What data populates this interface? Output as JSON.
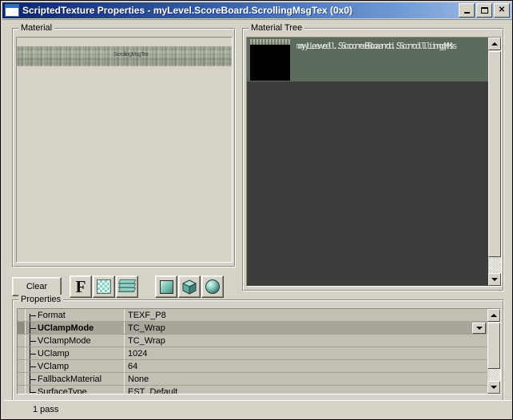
{
  "window": {
    "title": "ScriptedTexture Properties - myLevel.ScoreBoard.ScrollingMsgTex (0x0)",
    "icon": "window-icon",
    "controls": {
      "minimize": "minimize-icon",
      "maximize": "maximize-icon",
      "close": "✕"
    }
  },
  "material_panel": {
    "label": "Material",
    "preview_caption": "ScrollingMsgTex",
    "toolbar": {
      "clear_label": "Clear",
      "buttons": [
        {
          "name": "font-icon",
          "glyph": "F"
        },
        {
          "name": "checker-icon",
          "glyph": ""
        },
        {
          "name": "layers-icon",
          "glyph": ""
        },
        {
          "name": "plane-icon",
          "glyph": ""
        },
        {
          "name": "cube-icon",
          "glyph": ""
        },
        {
          "name": "sphere-icon",
          "glyph": ""
        }
      ]
    }
  },
  "material_tree": {
    "label": "Material Tree",
    "node_label": "myLevel.ScoreBoard.ScrollingMs"
  },
  "properties": {
    "label": "Properties",
    "selected_row": 1,
    "rows": [
      {
        "name": "Format",
        "value": "TEXF_P8"
      },
      {
        "name": "UClampMode",
        "value": "TC_Wrap"
      },
      {
        "name": "VClampMode",
        "value": "TC_Wrap"
      },
      {
        "name": "UClamp",
        "value": "1024"
      },
      {
        "name": "VClamp",
        "value": "64"
      },
      {
        "name": "FallbackMaterial",
        "value": "None"
      },
      {
        "name": "SurfaceType",
        "value": "EST_Default"
      }
    ]
  },
  "statusbar": {
    "text": "1 pass"
  },
  "colors": {
    "face": "#d6d2c8",
    "title_start": "#0a246a",
    "title_end": "#a8c5e8",
    "tree_background": "#3d3d3b",
    "tree_node": "#5d6b5d",
    "grid_background": "#c3bfb4",
    "selected_row": "#a9a59a",
    "icon_teal": "#7fd4c4"
  }
}
